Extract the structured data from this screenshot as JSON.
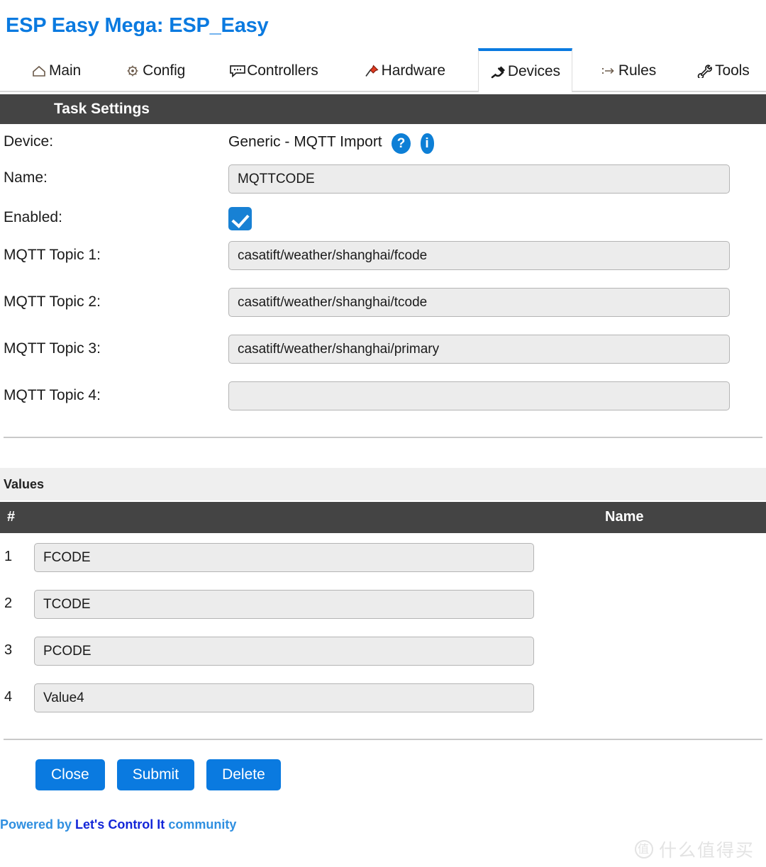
{
  "header": {
    "title": "ESP Easy Mega: ESP_Easy"
  },
  "nav": {
    "tabs": [
      {
        "label": "Main",
        "icon": "home-icon",
        "active": false
      },
      {
        "label": "Config",
        "icon": "gear-icon",
        "active": false
      },
      {
        "label": "Controllers",
        "icon": "speech-bubble-icon",
        "active": false
      },
      {
        "label": "Hardware",
        "icon": "pushpin-icon",
        "active": false
      },
      {
        "label": "Devices",
        "icon": "plug-icon",
        "active": true
      },
      {
        "label": "Rules",
        "icon": "arrow-rules-icon",
        "active": false
      },
      {
        "label": "Tools",
        "icon": "wrench-icon",
        "active": false
      }
    ]
  },
  "task_settings": {
    "section_title": "Task Settings",
    "device": {
      "label": "Device:",
      "value": "Generic - MQTT Import",
      "help_badge": "?",
      "info_badge": "i"
    },
    "name": {
      "label": "Name:",
      "value": "MQTTCODE"
    },
    "enabled": {
      "label": "Enabled:",
      "checked": true
    },
    "topics": [
      {
        "label": "MQTT Topic 1:",
        "value": "casatift/weather/shanghai/fcode"
      },
      {
        "label": "MQTT Topic 2:",
        "value": "casatift/weather/shanghai/tcode"
      },
      {
        "label": "MQTT Topic 3:",
        "value": "casatift/weather/shanghai/primary"
      },
      {
        "label": "MQTT Topic 4:",
        "value": ""
      }
    ]
  },
  "values": {
    "section_title": "Values",
    "columns": {
      "num": "#",
      "name": "Name"
    },
    "rows": [
      {
        "num": "1",
        "name": "FCODE"
      },
      {
        "num": "2",
        "name": "TCODE"
      },
      {
        "num": "3",
        "name": "PCODE"
      },
      {
        "num": "4",
        "name": "Value4"
      }
    ]
  },
  "actions": {
    "close": "Close",
    "submit": "Submit",
    "delete": "Delete"
  },
  "footer": {
    "prefix": "Powered by ",
    "brand": "Let's Control It",
    "suffix": " community"
  },
  "watermark": {
    "logo": "值",
    "text": "什么值得买"
  },
  "colors": {
    "accent": "#0a7ae0",
    "dark_bar": "#444444",
    "light_bar": "#efefef",
    "input_bg": "#ececec",
    "checkbox": "#1881d4",
    "footer_brand": "#1326d8"
  }
}
